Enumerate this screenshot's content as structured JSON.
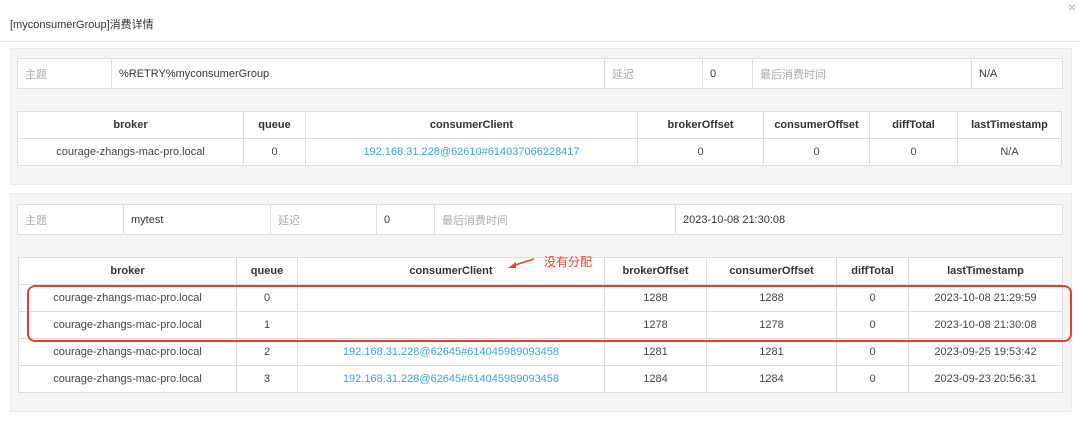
{
  "dialog": {
    "title": "[myconsumerGroup]消费详情",
    "close_label": "×"
  },
  "groups": [
    {
      "info": {
        "topic_label": "主题",
        "topic_value": "%RETRY%myconsumerGroup",
        "delay_label": "延迟",
        "delay_value": "0",
        "last_consume_label": "最后消费时间",
        "last_consume_value": "N/A"
      },
      "columns": [
        "broker",
        "queue",
        "consumerClient",
        "brokerOffset",
        "consumerOffset",
        "diffTotal",
        "lastTimestamp"
      ],
      "rows": [
        [
          "courage-zhangs-mac-pro.local",
          "0",
          "192.168.31.228@62610#614037066228417",
          "0",
          "0",
          "0",
          "N/A"
        ]
      ]
    },
    {
      "info": {
        "topic_label": "主题",
        "topic_value": "mytest",
        "delay_label": "延迟",
        "delay_value": "0",
        "last_consume_label": "最后消费时间",
        "last_consume_value": "2023-10-08 21:30:08"
      },
      "columns": [
        "broker",
        "queue",
        "consumerClient",
        "brokerOffset",
        "consumerOffset",
        "diffTotal",
        "lastTimestamp"
      ],
      "rows": [
        [
          "courage-zhangs-mac-pro.local",
          "0",
          "",
          "1288",
          "1288",
          "0",
          "2023-10-08 21:29:59"
        ],
        [
          "courage-zhangs-mac-pro.local",
          "1",
          "",
          "1278",
          "1278",
          "0",
          "2023-10-08 21:30:08"
        ],
        [
          "courage-zhangs-mac-pro.local",
          "2",
          "192.168.31.228@62645#614045989093458",
          "1281",
          "1281",
          "0",
          "2023-09-25 19:53:42"
        ],
        [
          "courage-zhangs-mac-pro.local",
          "3",
          "192.168.31.228@62645#614045989093458",
          "1284",
          "1284",
          "0",
          "2023-09-23 20:56:31"
        ]
      ]
    }
  ],
  "annotation": {
    "text": "没有分配",
    "color": "#e8402a"
  },
  "colors": {
    "link": "#3aa3d9",
    "section_bg": "#f5f5f5",
    "border": "#dddddd"
  }
}
